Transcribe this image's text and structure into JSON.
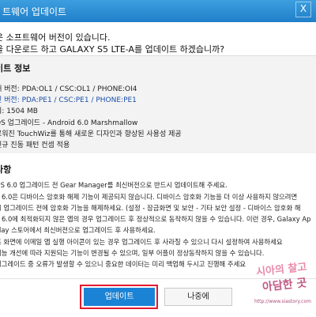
{
  "window": {
    "title": "트웨어 업데이트",
    "close_label": "X"
  },
  "message": {
    "line1": "운 소프트웨어 버전이 있습니다.",
    "line2": "을 다운로드 하고 GALAXY S5 LTE-A를 업데이트 하겠습니까?"
  },
  "update_info": {
    "heading": "이트 정보",
    "current_label": "재 버전:",
    "current_value": "PDA:OL1 / CSC:OL1 / PHONE:OI4",
    "new_label": "신 버전:",
    "new_value": "PDA:PE1 / CSC:PE1 / PHONE:PE1",
    "size_label": "기:",
    "size_value": "1504 MB",
    "feature1": "OS 업그레이드 - Android 6.0 Marshmallow",
    "feature2": "로워진 TouchWiz를 통해 새로운 디자인과 향상된 사용성 제공",
    "feature3": "신규 진동 패턴 컨셉 적용"
  },
  "notes": {
    "heading": "사항",
    "lines": [
      "OS 6.0 업그레이드 전 Gear Manager를 최신버전으로 반드시 업데이트해 주세요.",
      "S 6.0은 디바이스 암호화 해제 기능이 제공되지 않습니다. 디바이스 암호화 기능을 더 이상 사용하지 않으려면",
      "시 업그레이드 전에 암호화 기능을 해제하세요. (설정 - 잠금화면 및 보안 - 기타 보안 설정 - 디바이스 암호화 해",
      "S 6.0에 최적화되지 않은 앱의 경우 업그레이드 후 정상적으로 동작하지 않을 수 있습니다. 이런 경우, Galaxy Ap",
      "Play 스토어에서 최신버전으로 업그레이드 후 사용하세요.",
      "홈 화면에 이메일 앱 실행 아이콘이 있는 경우 업그레이드 후 사라질 수 있으니 다시 설정하여 사용하세요",
      "기능 개선에 따라 지원되는 기능이 변경될 수 있으며, 일부 어플이 정상동작하지 않을 수 있습니다.",
      "업그레이드 중 오류가 발생할 수 있으니 중요한 데이터는 미리 백업해 두시고 진행해 주세요"
    ]
  },
  "buttons": {
    "update": "업데이트",
    "later": "나중에"
  },
  "watermark": {
    "line1": "시아의 찰고",
    "line2": "아담한 곳",
    "url": "http://www.siastory.com"
  },
  "colors": {
    "titlebar": "#2a8fd6",
    "primary_button": "#1b83d6",
    "highlight": "#e5182f",
    "version_link": "#1a4fa8"
  }
}
